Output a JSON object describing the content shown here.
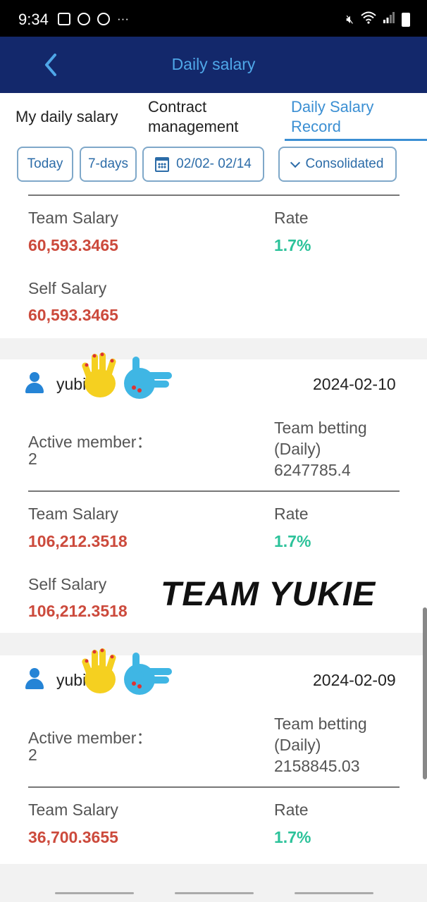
{
  "status_bar": {
    "time": "9:34",
    "dots": "···",
    "left_icons": [
      "image-icon",
      "chrome-icon",
      "chrome-icon"
    ],
    "right_icons": [
      "mute-icon",
      "wifi-icon",
      "signal-icon",
      "battery-icon"
    ]
  },
  "header": {
    "title": "Daily salary",
    "back_icon": "chevron-left-icon"
  },
  "tabs": [
    {
      "label_1": "My daily salary",
      "label_2": ""
    },
    {
      "label_1": "Contract",
      "label_2": "management"
    },
    {
      "label_1": "Daily Salary",
      "label_2": "Record",
      "active": true
    }
  ],
  "filters": {
    "today": "Today",
    "seven_days": "7-days",
    "date_range": "02/02- 02/14",
    "consolidated": "Consolidated"
  },
  "records": [
    {
      "team_salary_label": "Team Salary",
      "team_salary": "60,593.3465",
      "rate_label": "Rate",
      "rate": "1.7%",
      "self_salary_label": "Self Salary",
      "self_salary": "60,593.3465"
    },
    {
      "username": "yubin",
      "date": "2024-02-10",
      "active_member_label": "Active member：",
      "active_member": "2",
      "team_betting_label_1": "Team betting",
      "team_betting_label_2": "(Daily)",
      "team_betting": "6247785.4",
      "team_salary_label": "Team Salary",
      "team_salary": "106,212.3518",
      "rate_label": "Rate",
      "rate": "1.7%",
      "self_salary_label": "Self Salary",
      "self_salary": "106,212.3518"
    },
    {
      "username": "yubin",
      "date": "2024-02-09",
      "active_member_label": "Active member：",
      "active_member": "2",
      "team_betting_label_1": "Team betting",
      "team_betting_label_2": "(Daily)",
      "team_betting": "2158845.03",
      "team_salary_label": "Team Salary",
      "team_salary": "36,700.3655",
      "rate_label": "Rate",
      "rate": "1.7%"
    }
  ],
  "watermark": "TEAM YUKIE",
  "colors": {
    "header_bg": "#13286b",
    "accent_blue": "#3b8fd3",
    "salary_red": "#cc4a3c",
    "rate_green": "#2cc29a"
  }
}
